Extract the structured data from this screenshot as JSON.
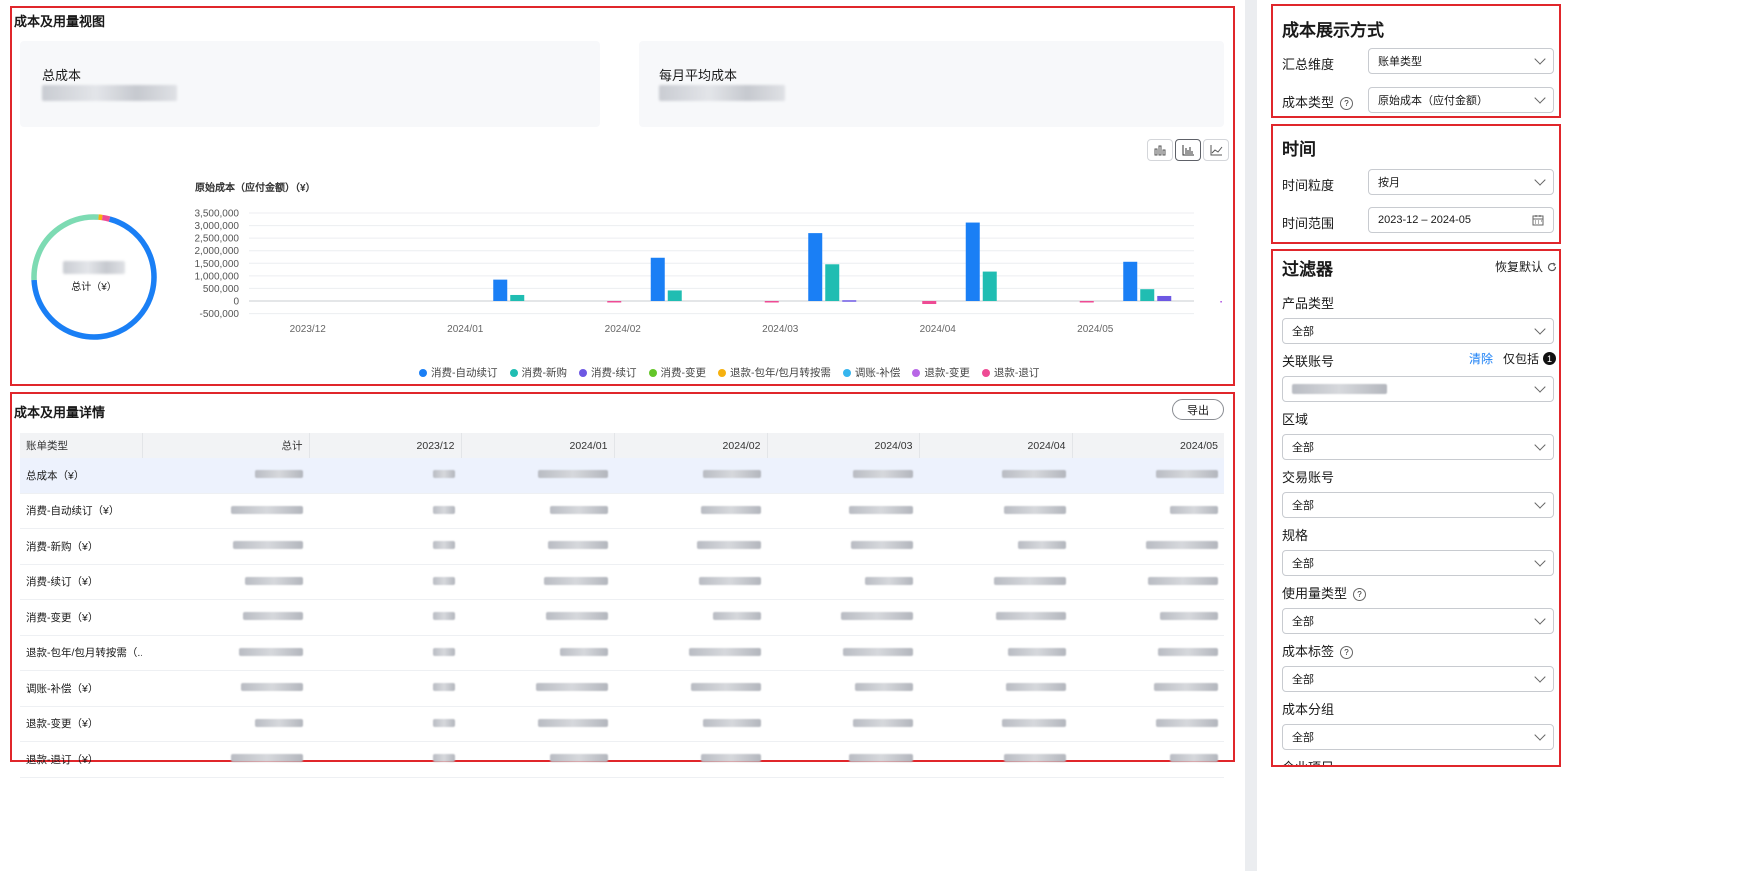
{
  "overview": {
    "title": "成本及用量视图",
    "total_cost_label": "总成本",
    "monthly_avg_label": "每月平均成本",
    "donut_center_label": "总计（¥）",
    "view_toggle_icons": [
      "stacked-bar-chart-icon",
      "bar-chart-icon",
      "line-chart-icon"
    ]
  },
  "chart_data": {
    "type": "bar",
    "title": "原始成本（应付金额）（¥）",
    "categories": [
      "2023/12",
      "2024/01",
      "2024/02",
      "2024/03",
      "2024/04",
      "2024/05"
    ],
    "y_ticks": [
      "3,500,000",
      "3,000,000",
      "2,500,000",
      "2,000,000",
      "1,500,000",
      "1,000,000",
      "500,000",
      "0",
      "-500,000"
    ],
    "ylim": [
      -500000,
      3500000
    ],
    "grid": true,
    "legend_position": "bottom",
    "series": [
      {
        "name": "消费-自动续订",
        "color": "#1a7ff5",
        "values": [
          0,
          850000,
          1720000,
          2700000,
          3120000,
          1560000
        ]
      },
      {
        "name": "消费-新购",
        "color": "#20bdb2",
        "values": [
          0,
          240000,
          420000,
          1460000,
          1170000,
          470000
        ]
      },
      {
        "name": "消费-续订",
        "color": "#6d58e3",
        "values": [
          0,
          0,
          0,
          30000,
          0,
          200000
        ]
      },
      {
        "name": "消费-变更",
        "color": "#64c629",
        "values": [
          0,
          0,
          0,
          0,
          0,
          0
        ]
      },
      {
        "name": "退款-包年/包月转按需",
        "color": "#f6b10f",
        "values": [
          0,
          0,
          0,
          0,
          0,
          0
        ]
      },
      {
        "name": "调账-补偿",
        "color": "#36b5ee",
        "values": [
          0,
          0,
          0,
          0,
          0,
          0
        ]
      },
      {
        "name": "退款-变更",
        "color": "#b867e6",
        "values": [
          0,
          0,
          0,
          0,
          0,
          -60000
        ]
      },
      {
        "name": "退款-退订",
        "color": "#ee4b94",
        "values": [
          0,
          -20000,
          -60000,
          -120000,
          -60000,
          -200000
        ]
      }
    ]
  },
  "donut": {
    "segments": [
      {
        "color": "#1a7ff5",
        "fraction": 0.7
      },
      {
        "color": "#7ddbb3",
        "fraction": 0.27
      },
      {
        "color": "#f6b10f",
        "fraction": 0.01
      },
      {
        "color": "#ee4b94",
        "fraction": 0.02
      }
    ]
  },
  "details": {
    "title": "成本及用量详情",
    "export_label": "导出",
    "columns": [
      "账单类型",
      "总计",
      "2023/12",
      "2024/01",
      "2024/02",
      "2024/03",
      "2024/04",
      "2024/05"
    ],
    "rows": [
      {
        "label": "总成本（¥）",
        "highlight": true
      },
      {
        "label": "消费-自动续订（¥）"
      },
      {
        "label": "消费-新购（¥）"
      },
      {
        "label": "消费-续订（¥）"
      },
      {
        "label": "消费-变更（¥）"
      },
      {
        "label": "退款-包年/包月转按需（..."
      },
      {
        "label": "调账-补偿（¥）"
      },
      {
        "label": "退款-变更（¥）"
      },
      {
        "label": "退款-退订（¥）"
      }
    ]
  },
  "display_mode": {
    "title": "成本展示方式",
    "fields": [
      {
        "label": "汇总维度",
        "value": "账单类型",
        "help": false
      },
      {
        "label": "成本类型",
        "value": "原始成本（应付金额）",
        "help": true
      }
    ]
  },
  "time": {
    "title": "时间",
    "granularity_label": "时间粒度",
    "granularity_value": "按月",
    "range_label": "时间范围",
    "range_value": "2023-12 – 2024-05"
  },
  "filters": {
    "title": "过滤器",
    "reset_label": "恢复默认",
    "clear_label": "清除",
    "only_include_label": "仅包括",
    "only_include_count": "1",
    "items": [
      {
        "label": "产品类型",
        "value": "全部",
        "help": false
      },
      {
        "label": "关联账号",
        "value": "",
        "help": false
      },
      {
        "label": "区域",
        "value": "全部",
        "help": false
      },
      {
        "label": "交易账号",
        "value": "全部",
        "help": false
      },
      {
        "label": "规格",
        "value": "全部",
        "help": false
      },
      {
        "label": "使用量类型",
        "value": "全部",
        "help": true
      },
      {
        "label": "成本标签",
        "value": "全部",
        "help": true
      },
      {
        "label": "成本分组",
        "value": "全部",
        "help": false
      }
    ],
    "next_label": "企业项目"
  }
}
